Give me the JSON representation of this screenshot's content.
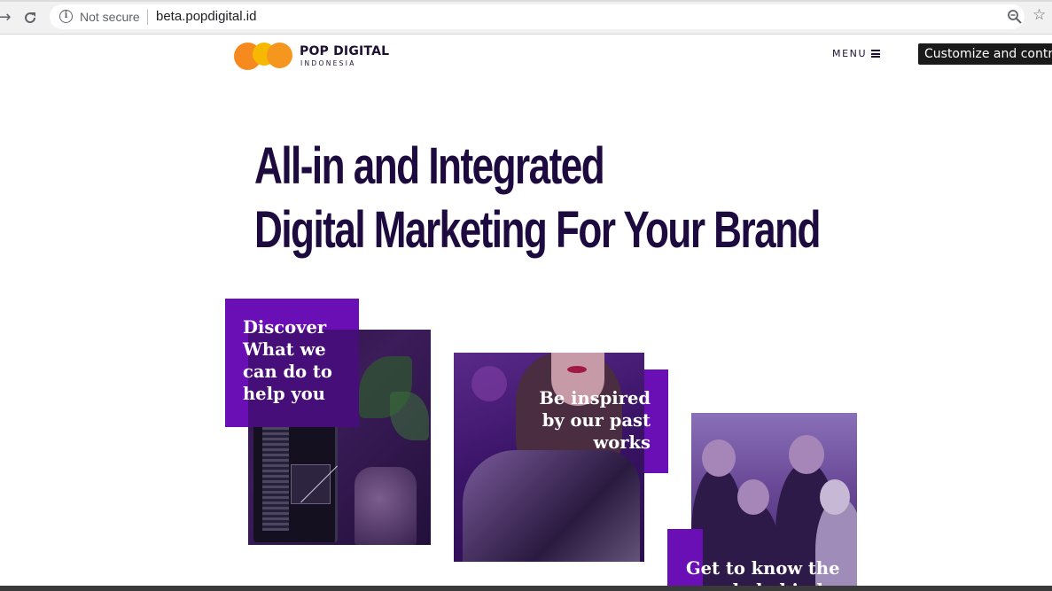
{
  "browser": {
    "security_label": "Not secure",
    "url": "beta.popdigital.id",
    "tooltip": "Customize and control"
  },
  "site": {
    "logo_name": "POP DIGITAL",
    "logo_sub": "INDONESIA",
    "menu_label": "MENU",
    "brand_colors": [
      "#f68a1f",
      "#f6b800",
      "#f5961f"
    ],
    "accent": "#6a0fb5",
    "heading_color": "#1d0a3f"
  },
  "hero": {
    "line1": "All-in and Integrated",
    "line2": "Digital Marketing For Your Brand"
  },
  "cards": [
    {
      "text_lines": [
        "Discover",
        "What we",
        "can do to",
        "help you"
      ]
    },
    {
      "text_lines": [
        "Be inspired",
        "by our past",
        "works"
      ]
    },
    {
      "text_lines": [
        "Get to know the",
        "people behind"
      ]
    }
  ]
}
